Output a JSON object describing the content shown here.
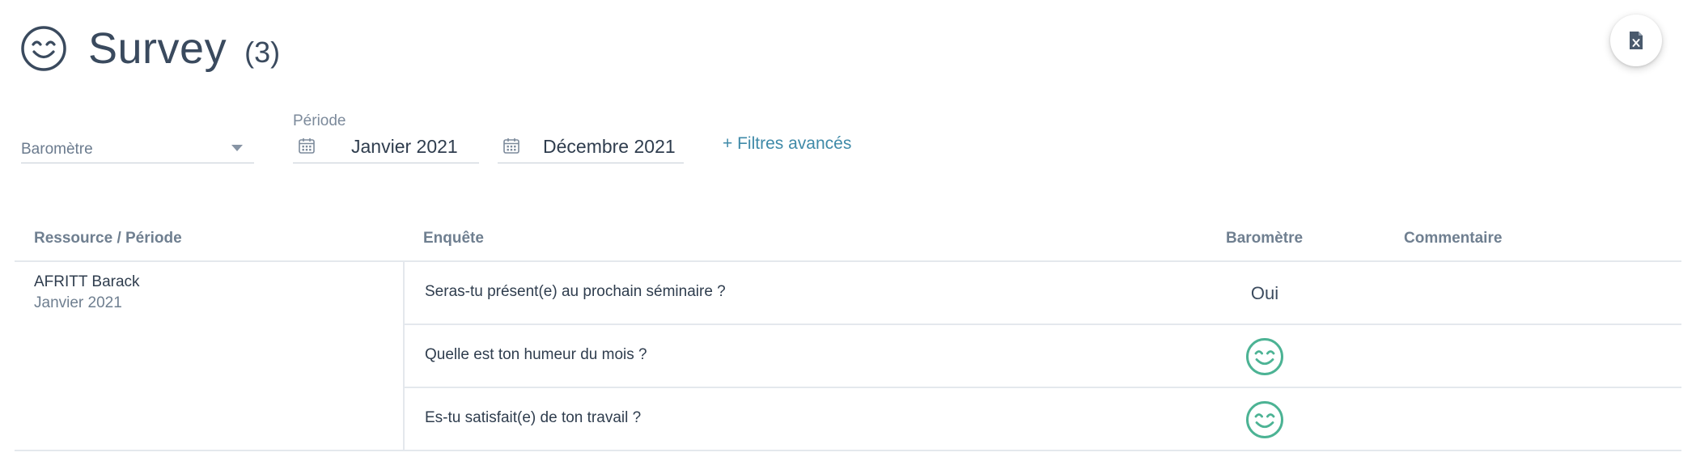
{
  "header": {
    "title": "Survey",
    "count": "(3)",
    "icon": "smiley-icon"
  },
  "toolbar": {
    "export_icon": "excel-file-icon"
  },
  "filters": {
    "barometer": {
      "value": "Baromètre"
    },
    "period": {
      "label": "Période",
      "start": "Janvier 2021",
      "end": "Décembre 2021",
      "icon": "calendar-icon"
    },
    "advanced_label": "+ Filtres avancés"
  },
  "table": {
    "columns": {
      "resource": "Ressource / Période",
      "survey": "Enquête",
      "barometer": "Baromètre",
      "comment": "Commentaire"
    },
    "groups": [
      {
        "resource": "AFRITT Barack",
        "period": "Janvier 2021",
        "rows": [
          {
            "question": "Seras-tu présent(e) au prochain séminaire ?",
            "answer_text": "Oui"
          },
          {
            "question": "Quelle est ton humeur du mois ?",
            "answer_icon": "happy-smiley-icon"
          },
          {
            "question": "Es-tu satisfait(e) de ton travail ?",
            "answer_icon": "happy-smiley-icon"
          }
        ]
      }
    ]
  },
  "colors": {
    "accent": "#3f8aa8",
    "smiley_green": "#4cb394",
    "text_dark": "#2f3d4e",
    "text_muted": "#6f7f90",
    "border": "#e4e8ed"
  }
}
